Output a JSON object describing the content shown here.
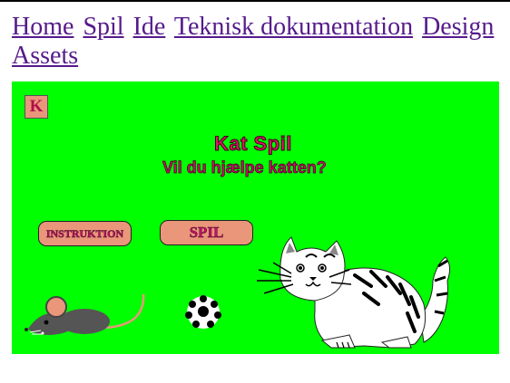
{
  "nav": {
    "links": [
      "Home",
      "Spil",
      "Ide",
      "Teknisk dokumentation",
      "Design",
      "Assets"
    ]
  },
  "game": {
    "k_button_label": "K",
    "title": "Kat Spil",
    "subtitle": "Vil du hjælpe katten?",
    "instruction_button_label": "INSTRUKTION",
    "play_button_label": "SPIL",
    "colors": {
      "background": "#00ff00",
      "button": "#e9967a",
      "title_text": "#e0156a",
      "link": "#551a8b"
    },
    "icons": [
      "mouse-icon",
      "ball-icon",
      "cat-icon"
    ]
  }
}
